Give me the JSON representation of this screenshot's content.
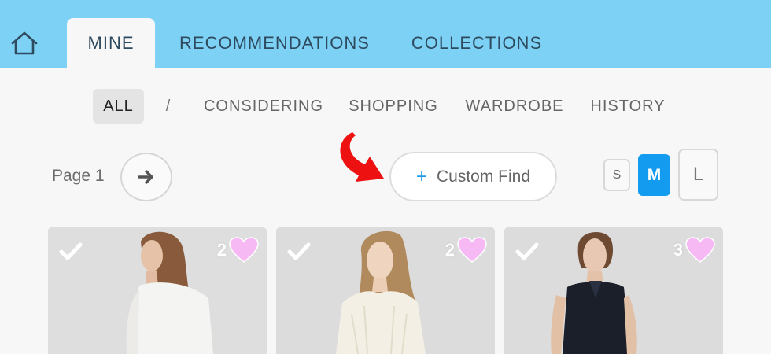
{
  "nav": {
    "home_icon": "home-icon",
    "tabs": [
      {
        "label": "MINE",
        "active": true
      },
      {
        "label": "RECOMMENDATIONS",
        "active": false
      },
      {
        "label": "COLLECTIONS",
        "active": false
      }
    ]
  },
  "filters": {
    "items": [
      {
        "label": "ALL",
        "active": true
      },
      {
        "label": "/",
        "active": false
      },
      {
        "label": "CONSIDERING",
        "active": false
      },
      {
        "label": "SHOPPING",
        "active": false
      },
      {
        "label": "WARDROBE",
        "active": false
      },
      {
        "label": "HISTORY",
        "active": false
      }
    ]
  },
  "toolbar": {
    "page_label": "Page 1",
    "next_icon": "arrow-right-icon",
    "custom_find_icon": "+",
    "custom_find_label": "Custom Find",
    "sizes": [
      "S",
      "M",
      "L"
    ],
    "selected_size": "M"
  },
  "colors": {
    "topbar": "#7dd1f5",
    "accent": "#139bef",
    "heart": "#f7b9f3",
    "annotation_arrow": "#ee1111"
  },
  "products": [
    {
      "check_icon": "check-icon",
      "likes": "2",
      "heart_icon": "heart-icon"
    },
    {
      "check_icon": "check-icon",
      "likes": "2",
      "heart_icon": "heart-icon"
    },
    {
      "check_icon": "check-icon",
      "likes": "3",
      "heart_icon": "heart-icon"
    }
  ]
}
